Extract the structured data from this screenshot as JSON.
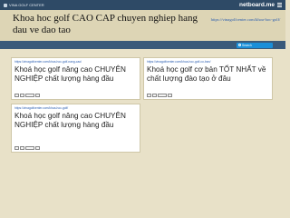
{
  "topbar": {
    "site_tag": "VINA GOLF CENTER",
    "brand": "netboard.me"
  },
  "header": {
    "title": "Khoa hoc golf CAO CAP chuyen nghiep hang dau ve dao tao",
    "url": "https://vinagolfcenter.com/khoa-hoc-golf/"
  },
  "search": {
    "label": "Search"
  },
  "cards": [
    {
      "url": "https://vinagolfcenter.com/khoa-hoc-golf-nang-cao/",
      "title": "Khoá học golf nâng cao CHUYÊN NGHIỆP chất lượng hàng đầu"
    },
    {
      "url": "https://vinagolfcenter.com/khoa-hoc-golf-co-ban/",
      "title": "Khoá học golf cơ bản TỐT NHẤT về chất lượng đào tạo ở đâu"
    },
    {
      "url": "https://vinagolfcenter.com/khoa-hoc-golf/",
      "title": "Khoá học golf nâng cao CHUYÊN NGHIỆP chất lượng hàng đầu"
    }
  ],
  "colors": {
    "background": "#e8e1c8",
    "topbar": "#2e4a66",
    "navbar": "#3a5a7a",
    "search": "#1a8fd8",
    "link": "#2a5db0"
  }
}
